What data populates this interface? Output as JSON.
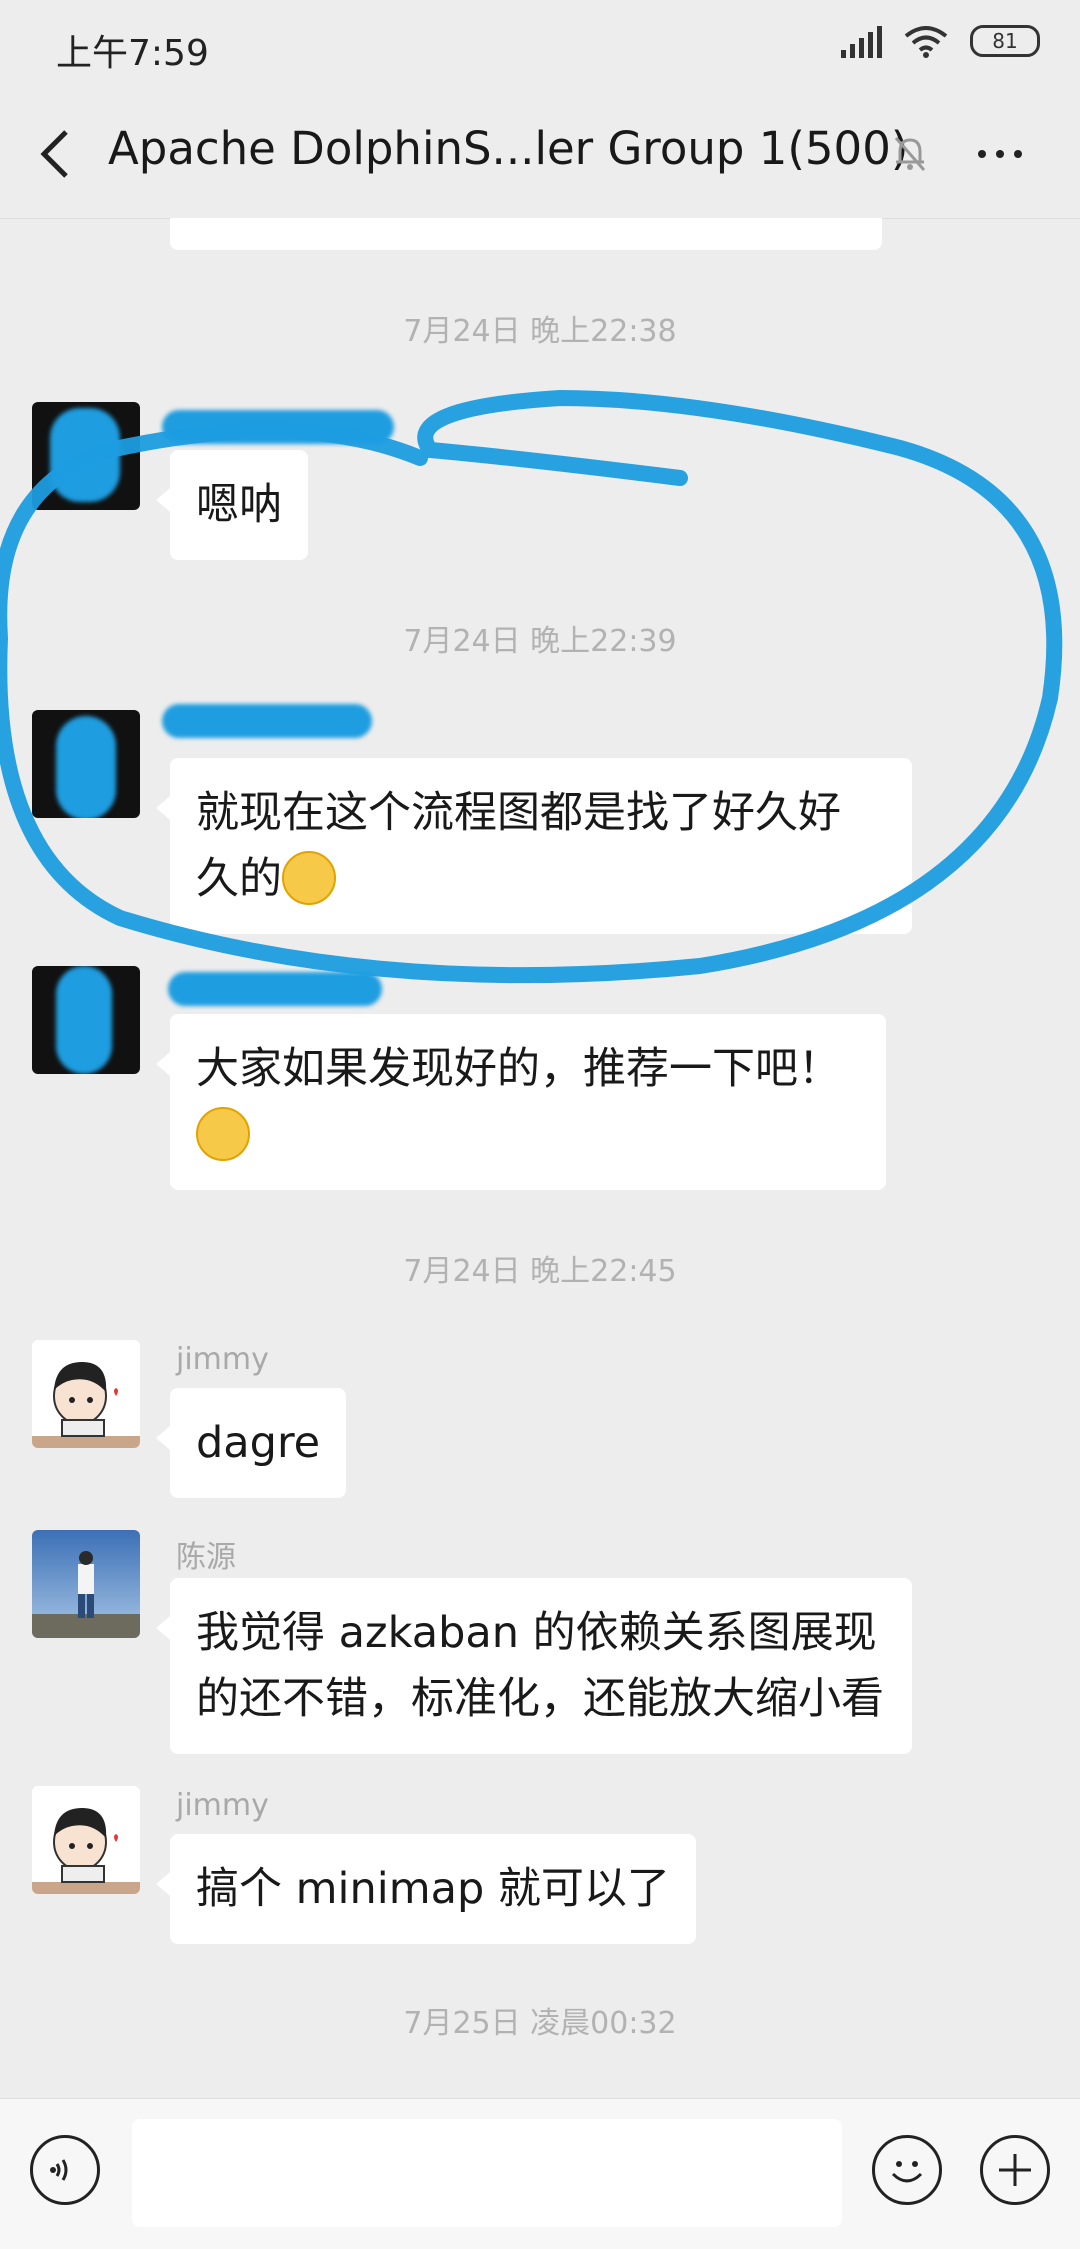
{
  "status": {
    "time": "上午7:59",
    "battery": "81"
  },
  "header": {
    "title": "Apache DolphinS...ler Group 1(500)"
  },
  "chat": {
    "timestamps": [
      "7月24日 晚上22:38",
      "7月24日 晚上22:39",
      "7月24日 晚上22:45",
      "7月25日 凌晨00:32"
    ],
    "messages": [
      {
        "text": "嗯呐"
      },
      {
        "text_line1": "就现在这个流程图都是找了好久好",
        "text_line2": "久的"
      },
      {
        "text_line1": "大家如果发现好的，推荐一下吧！"
      },
      {
        "sender": "jimmy",
        "text": "dagre"
      },
      {
        "sender": "陈源",
        "text_line1": "我觉得 azkaban 的依赖关系图展现",
        "text_line2": "的还不错，标准化，还能放大缩小看"
      },
      {
        "sender": "jimmy",
        "text": "搞个 minimap 就可以了"
      }
    ]
  },
  "icons": [
    "back-arrow-icon",
    "mute-bell-icon",
    "more-icon",
    "voice-icon",
    "emoji-icon",
    "plus-icon"
  ],
  "colors": {
    "background": "#ededed",
    "bubble": "#ffffff",
    "scribble": "#1e9de0"
  }
}
